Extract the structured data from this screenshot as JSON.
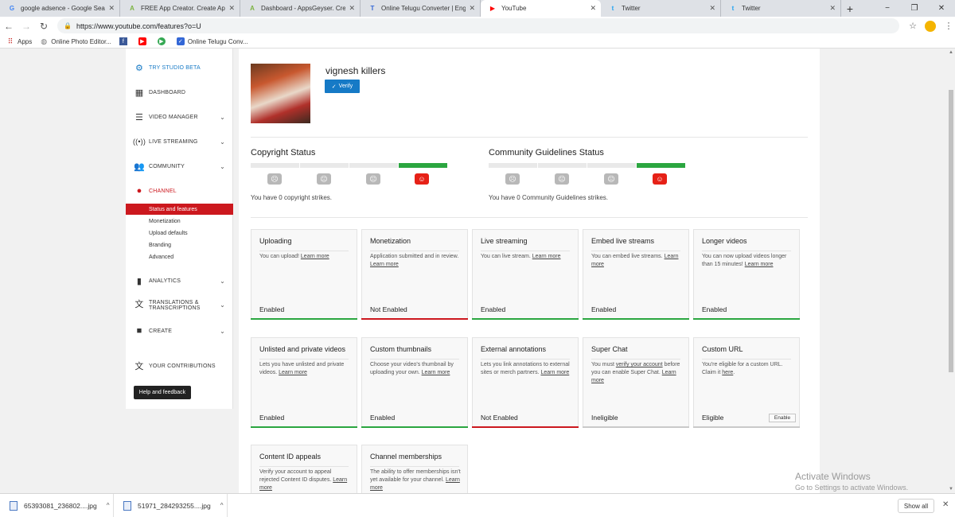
{
  "browser": {
    "tabs": [
      {
        "title": "google adsence - Google Search",
        "icon": "G",
        "icon_color": "#4285f4"
      },
      {
        "title": "FREE App Creator. Create Apps f",
        "icon": "A",
        "icon_color": "#7cb342"
      },
      {
        "title": "Dashboard - AppsGeyser. Create",
        "icon": "A",
        "icon_color": "#7cb342"
      },
      {
        "title": "Online Telugu Converter | English",
        "icon": "T",
        "icon_color": "#3367d6"
      },
      {
        "title": "YouTube",
        "icon": "▶",
        "icon_color": "#ff0000"
      },
      {
        "title": "Twitter",
        "icon": "t",
        "icon_color": "#1da1f2"
      },
      {
        "title": "Twitter",
        "icon": "t",
        "icon_color": "#1da1f2"
      }
    ],
    "url": "https://www.youtube.com/features?o=U",
    "bookmarks": [
      "Apps",
      "Online Photo Editor...",
      "Online Telugu Conv..."
    ],
    "window_controls": [
      "−",
      "❐",
      "✕"
    ]
  },
  "sidebar": {
    "studio_beta": "TRY STUDIO BETA",
    "dashboard": "DASHBOARD",
    "video_manager": "VIDEO MANAGER",
    "live_streaming": "LIVE STREAMING",
    "community": "COMMUNITY",
    "channel": "CHANNEL",
    "channel_sub": [
      "Status and features",
      "Monetization",
      "Upload defaults",
      "Branding",
      "Advanced"
    ],
    "analytics": "ANALYTICS",
    "translations_1": "TRANSLATIONS &",
    "translations_2": "TRANSCRIPTIONS",
    "create": "CREATE",
    "contributions": "YOUR CONTRIBUTIONS",
    "help": "Help and feedback"
  },
  "channel": {
    "name": "vignesh killers",
    "verify_label": "Verify"
  },
  "copyright": {
    "title": "Copyright Status",
    "text": "You have 0 copyright strikes."
  },
  "community_status": {
    "title": "Community Guidelines Status",
    "text": "You have 0 Community Guidelines strikes."
  },
  "features": [
    {
      "title": "Uploading",
      "desc": "You can upload! ",
      "link": "Learn more",
      "status": "Enabled",
      "bar": "green"
    },
    {
      "title": "Monetization",
      "desc": "Application submitted and in review. ",
      "link": "Learn more",
      "status": "Not Enabled",
      "bar": "red"
    },
    {
      "title": "Live streaming",
      "desc": "You can live stream. ",
      "link": "Learn more",
      "status": "Enabled",
      "bar": "green"
    },
    {
      "title": "Embed live streams",
      "desc": "You can embed live streams. ",
      "link": "Learn more",
      "status": "Enabled",
      "bar": "green"
    },
    {
      "title": "Longer videos",
      "desc": "You can now upload videos longer than 15 minutes! ",
      "link": "Learn more",
      "status": "Enabled",
      "bar": "green"
    },
    {
      "title": "Unlisted and private videos",
      "desc": "Lets you have unlisted and private videos. ",
      "link": "Learn more",
      "status": "Enabled",
      "bar": "green"
    },
    {
      "title": "Custom thumbnails",
      "desc": "Choose your video's thumbnail by uploading your own. ",
      "link": "Learn more",
      "status": "Enabled",
      "bar": "green"
    },
    {
      "title": "External annotations",
      "desc": "Lets you link annotations to external sites or merch partners. ",
      "link": "Learn more",
      "status": "Not Enabled",
      "bar": "red"
    },
    {
      "title": "Super Chat",
      "desc_pre": "You must ",
      "desc_link1": "verify your account",
      "desc_post": " before you can enable Super Chat. ",
      "link": "Learn more",
      "status": "Ineligible",
      "bar": "gray"
    },
    {
      "title": "Custom URL",
      "desc": "You're eligible for a custom URL. Claim it ",
      "link": "here",
      "status": "Eligible",
      "bar": "gray",
      "button": "Enable"
    },
    {
      "title": "Content ID appeals",
      "desc": "Verify your account to appeal rejected Content ID disputes. ",
      "link": "Learn more",
      "status": "",
      "bar": "gray"
    },
    {
      "title": "Channel memberships",
      "desc": "The ability to offer memberships isn't yet available for your channel. ",
      "link": "Learn more",
      "status": "",
      "bar": "gray"
    }
  ],
  "watermark": {
    "line1": "Activate Windows",
    "line2": "Go to Settings to activate Windows."
  },
  "downloads": {
    "items": [
      "65393081_236802....jpg",
      "51971_284293255....jpg"
    ],
    "show_all": "Show all"
  }
}
